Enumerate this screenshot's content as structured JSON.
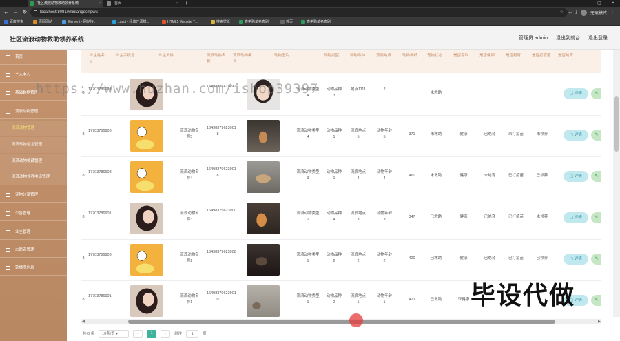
{
  "browser": {
    "tabs": [
      "社区流浪动物救助领养系统",
      "首页"
    ],
    "url": "localhost:8081/#/liulangdongwu",
    "profile": "无痕模式",
    "bookmarks": [
      "百度搜索",
      "原码网站",
      "Element - 网站快...",
      "Layui - 经典开源模...",
      "HTML5 Website T...",
      "搜索壁纸",
      "表格购单名表刷",
      "首页",
      "表格购单名表刷"
    ]
  },
  "header": {
    "title": "社区流浪动物救助领养系统",
    "admin": "管理员 admin",
    "back_front": "退出到前台",
    "logout": "退出登录"
  },
  "sidebar": {
    "items": [
      "首页",
      "个人中心",
      "基础数据管理",
      "流浪动物管理",
      "宠物分享管理",
      "公告管理",
      "业主管理",
      "志愿者管理",
      "轮播图信息"
    ],
    "subitems": [
      "流浪动物管理",
      "流浪动物留言管理",
      "流浪动物收藏管理",
      "流浪动物领养申请管理"
    ]
  },
  "table": {
    "headers": [
      "业主姓名",
      "业主手机号",
      "业主头像",
      "流浪动物名称",
      "流浪动物编号",
      "动物图片",
      "动物类型",
      "动物品种",
      "流浪地点",
      "动物年龄",
      "宠物状态",
      "是否喜欢",
      "是否健康",
      "是否有育",
      "是否打疫苗",
      "是否绝育"
    ],
    "detail_label": "详情",
    "rows": [
      {
        "name": "",
        "phone": "17703786901",
        "petname": "",
        "code": "1649837741149",
        "type": "流浪动物类型4",
        "breed": "动物品种3",
        "place": "地点1111",
        "age": "2",
        "status": "未救助",
        "health": "",
        "prof": "",
        "vacc": "",
        "neuter": ""
      },
      {
        "name": "",
        "phone": "17703786903",
        "petname": "流浪动物名称5",
        "code": "16498379623901 8",
        "type": "流浪动物类型4",
        "breed": "动物品种1",
        "place": "流浪地点5",
        "age": "动物年龄5",
        "agenum": "371",
        "status": "未救助",
        "health": "健康",
        "prof": "已绝育",
        "vacc": "未打疫苗",
        "neuter": "未领养"
      },
      {
        "name": "",
        "phone": "17703786903",
        "petname": "流浪动物名称4",
        "code": "16498379623901 8",
        "type": "流浪动物类型3",
        "breed": "动物品种1",
        "place": "流浪地点4",
        "age": "动物年龄4",
        "agenum": "460",
        "status": "未救助",
        "health": "健康",
        "prof": "未绝育",
        "vacc": "已打疫苗",
        "neuter": "已领养"
      },
      {
        "name": "",
        "phone": "17703786901",
        "petname": "流浪动物名称3",
        "code": "16498379623900",
        "type": "流浪动物类型2",
        "breed": "动物品种4",
        "place": "流浪地点3",
        "age": "动物年龄3",
        "agenum": "347",
        "status": "已救助",
        "health": "健康",
        "prof": "已绝育",
        "vacc": "已打疫苗",
        "neuter": "未领养"
      },
      {
        "name": "",
        "phone": "17703786903",
        "petname": "流浪动物名称2",
        "code": "16498379623908",
        "type": "流浪动物类型1",
        "breed": "动物品种2",
        "place": "流浪地点2",
        "age": "动物年龄2",
        "agenum": "420",
        "status": "已救助",
        "health": "健康",
        "prof": "已绝育",
        "vacc": "已打疫苗",
        "neuter": "已领养"
      },
      {
        "name": "",
        "phone": "17703786901",
        "petname": "流浪动物名称1",
        "code": "16498379623901 0",
        "type": "流浪动物类型1",
        "breed": "动物品种2",
        "place": "流浪地点1",
        "age": "动物年龄1",
        "agenum": "471",
        "status": "已救助",
        "health": "亚健康",
        "prof": "",
        "vacc": "",
        "neuter": ""
      }
    ]
  },
  "pager": {
    "total": "共 6 条",
    "per_page": "10条/页",
    "page": "1",
    "goto": "前往",
    "goto_val": "1",
    "page_unit": "页"
  },
  "watermark_url": "https://www.huzhan.com/ishop39397",
  "watermark_text": "毕设代做"
}
